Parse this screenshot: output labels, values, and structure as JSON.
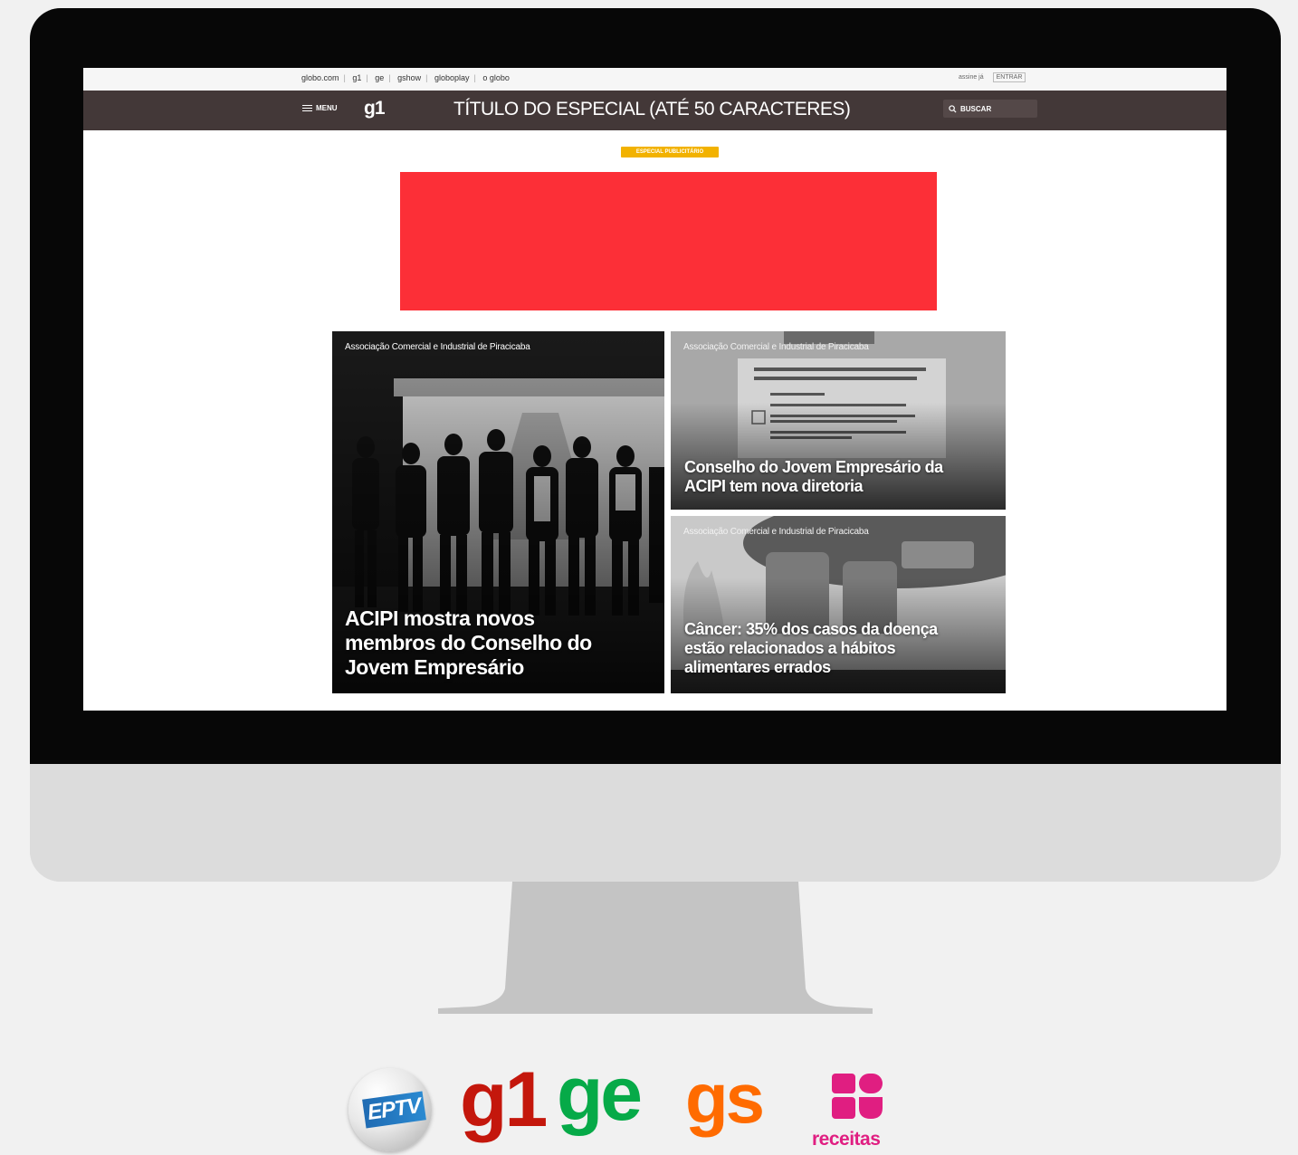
{
  "topbar": {
    "links": [
      "globo.com",
      "g1",
      "ge",
      "gshow",
      "globoplay",
      "o globo"
    ],
    "assine": "assine já",
    "entrar": "ENTRAR"
  },
  "header": {
    "menu_label": "MENU",
    "logo": "g1",
    "title": "TÍTULO DO ESPECIAL (ATÉ 50 CARACTERES)",
    "search_label": "BUSCAR"
  },
  "badge": "ESPECIAL PUBLICITÁRIO",
  "banner": {
    "color": "#fc2f37"
  },
  "cards": [
    {
      "source": "Associação Comercial e Industrial de Piracicaba",
      "headline": "ACIPI mostra novos membros do Conselho do Jovem Empresário"
    },
    {
      "source": "Associação Comercial e Industrial de Piracicaba",
      "headline": "Conselho do Jovem Empresário da ACIPI tem nova diretoria"
    },
    {
      "source": "Associação Comercial e Industrial de Piracicaba",
      "headline": "Câncer: 35% dos casos da doença estão relacionados a hábitos alimentares errados"
    }
  ],
  "brands": {
    "eptv": "EPTV",
    "g1": "g1",
    "ge": "ge",
    "gs": "gs",
    "receitas": "receitas"
  },
  "colors": {
    "header_bg": "#433838",
    "badge_bg": "#f2b200",
    "g1": "#c4170c",
    "ge": "#06aa48",
    "gs": "#ff6b00",
    "receitas": "#e01e81"
  }
}
